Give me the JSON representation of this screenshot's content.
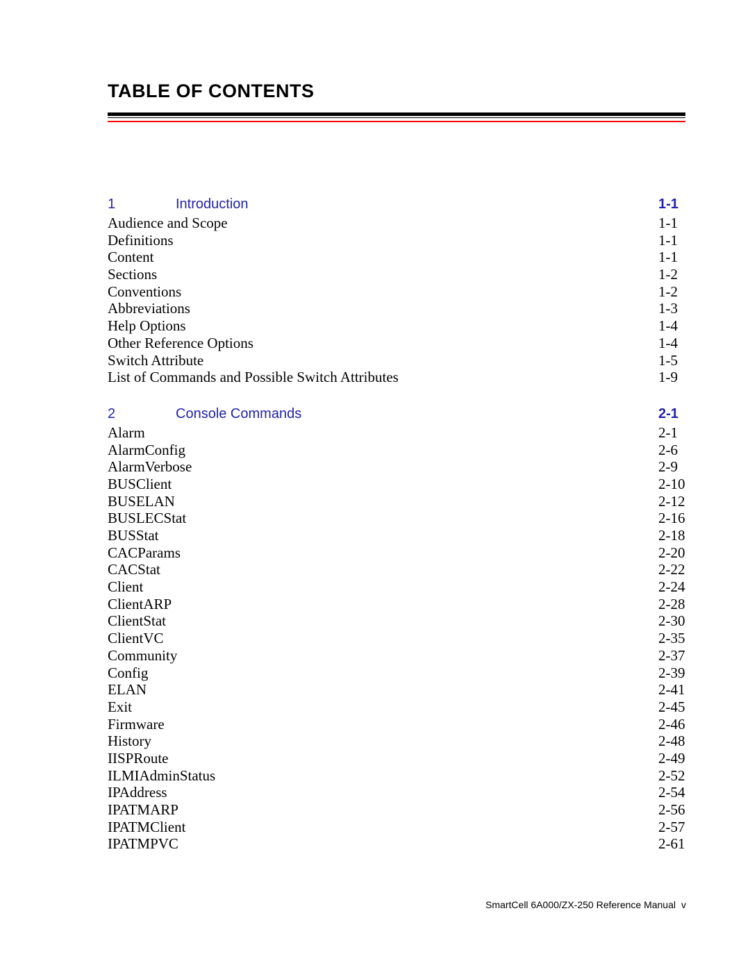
{
  "document": {
    "title": "TABLE OF CONTENTS",
    "accent_rule_color": "#ff0000",
    "rule_color": "#000000",
    "chapter_color": "#2222aa"
  },
  "toc": {
    "chapters": [
      {
        "number": "1",
        "name": "Introduction",
        "page": "1-1",
        "entries": [
          {
            "label": "Audience and Scope",
            "page": "1-1"
          },
          {
            "label": "Definitions",
            "page": "1-1"
          },
          {
            "label": "Content",
            "page": "1-1"
          },
          {
            "label": "Sections",
            "page": "1-2"
          },
          {
            "label": "Conventions",
            "page": "1-2"
          },
          {
            "label": "Abbreviations",
            "page": "1-3"
          },
          {
            "label": "Help Options",
            "page": "1-4"
          },
          {
            "label": "Other Reference Options",
            "page": "1-4"
          },
          {
            "label": "Switch Attribute",
            "page": "1-5"
          },
          {
            "label": "List of Commands and Possible Switch Attributes",
            "page": "1-9"
          }
        ]
      },
      {
        "number": "2",
        "name": "Console Commands",
        "page": "2-1",
        "entries": [
          {
            "label": "Alarm",
            "page": "2-1"
          },
          {
            "label": "AlarmConfig",
            "page": "2-6"
          },
          {
            "label": "AlarmVerbose",
            "page": "2-9"
          },
          {
            "label": "BUSClient",
            "page": "2-10"
          },
          {
            "label": "BUSELAN",
            "page": "2-12"
          },
          {
            "label": "BUSLECStat",
            "page": "2-16"
          },
          {
            "label": "BUSStat",
            "page": "2-18"
          },
          {
            "label": "CACParams",
            "page": "2-20"
          },
          {
            "label": "CACStat",
            "page": "2-22"
          },
          {
            "label": "Client",
            "page": "2-24"
          },
          {
            "label": "ClientARP",
            "page": "2-28"
          },
          {
            "label": "ClientStat",
            "page": "2-30"
          },
          {
            "label": "ClientVC",
            "page": "2-35"
          },
          {
            "label": "Community",
            "page": "2-37"
          },
          {
            "label": "Config",
            "page": "2-39"
          },
          {
            "label": "ELAN",
            "page": "2-41"
          },
          {
            "label": "Exit",
            "page": "2-45"
          },
          {
            "label": "Firmware",
            "page": "2-46"
          },
          {
            "label": "History",
            "page": "2-48"
          },
          {
            "label": "IISPRoute",
            "page": "2-49"
          },
          {
            "label": "ILMIAdminStatus",
            "page": "2-52"
          },
          {
            "label": "IPAddress",
            "page": "2-54"
          },
          {
            "label": "IPATMARP",
            "page": "2-56"
          },
          {
            "label": "IPATMClient",
            "page": "2-57"
          },
          {
            "label": "IPATMPVC",
            "page": "2-61"
          }
        ]
      }
    ]
  },
  "footer": {
    "manual_name": "SmartCell 6A000/ZX-250 Reference Manual",
    "folio": "v"
  }
}
